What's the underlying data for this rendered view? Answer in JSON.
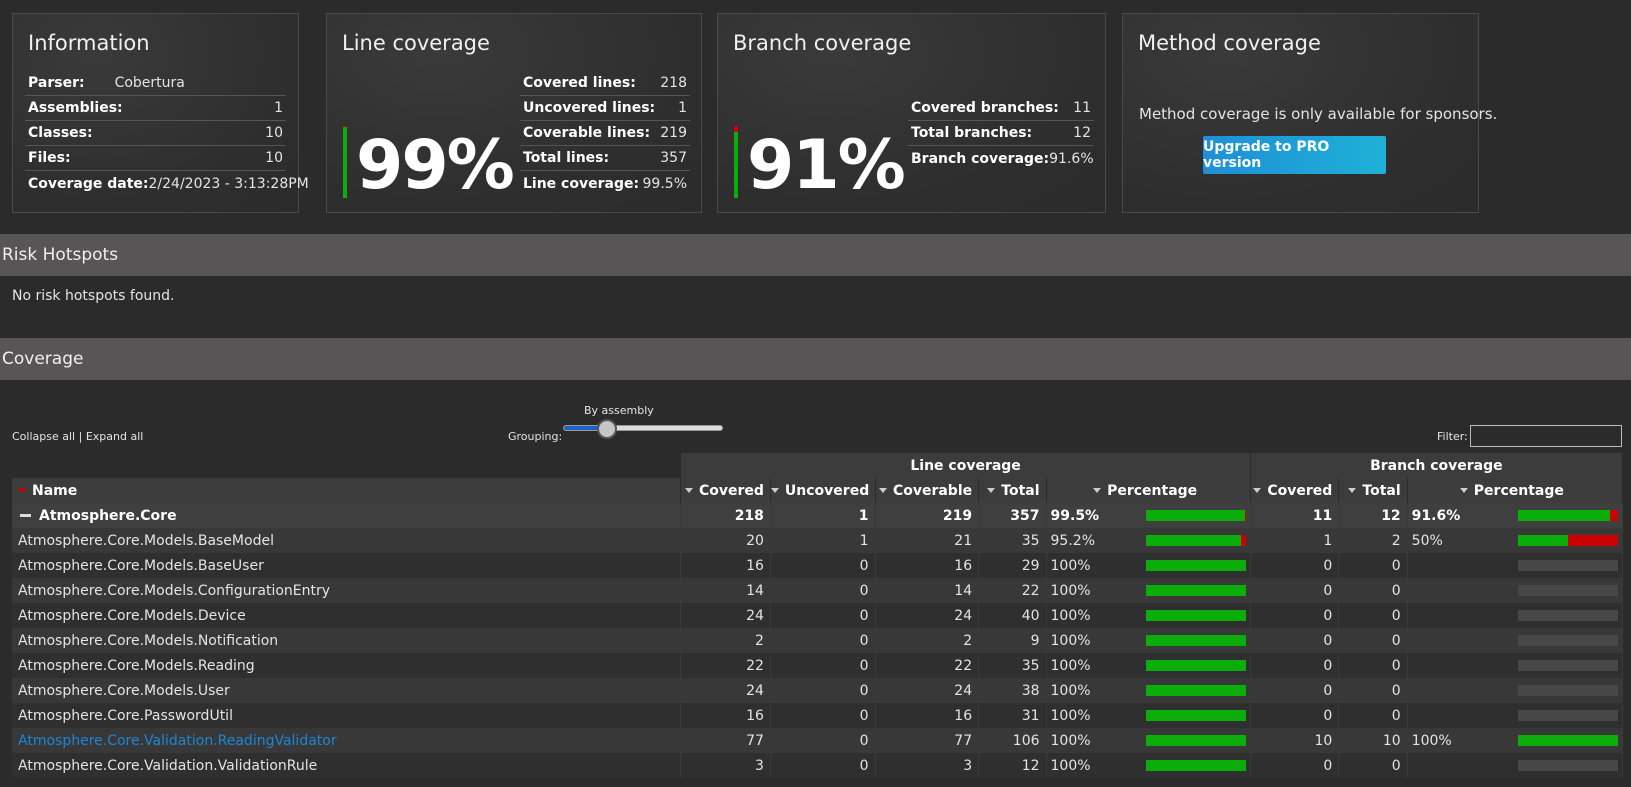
{
  "information": {
    "title": "Information",
    "rows": [
      {
        "k": "Parser:",
        "v": "Cobertura"
      },
      {
        "k": "Assemblies:",
        "v": "1"
      },
      {
        "k": "Classes:",
        "v": "10"
      },
      {
        "k": "Files:",
        "v": "10"
      },
      {
        "k": "Coverage date:",
        "v": "2/24/2023 - 3:13:28PM"
      }
    ]
  },
  "line_coverage": {
    "title": "Line coverage",
    "big": "99%",
    "fraction": 0.995,
    "rows": [
      {
        "k": "Covered lines:",
        "v": "218"
      },
      {
        "k": "Uncovered lines:",
        "v": "1"
      },
      {
        "k": "Coverable lines:",
        "v": "219"
      },
      {
        "k": "Total lines:",
        "v": "357"
      },
      {
        "k": "Line coverage:",
        "v": "99.5%"
      }
    ]
  },
  "branch_coverage": {
    "title": "Branch coverage",
    "big": "91%",
    "fraction": 0.916,
    "rows": [
      {
        "k": "Covered branches:",
        "v": "11"
      },
      {
        "k": "Total branches:",
        "v": "12"
      },
      {
        "k": "Branch coverage:",
        "v": "91.6%"
      }
    ]
  },
  "method_coverage": {
    "title": "Method coverage",
    "text": "Method coverage is only available for sponsors.",
    "button": "Upgrade to PRO version"
  },
  "risk": {
    "title": "Risk Hotspots",
    "empty": "No risk hotspots found."
  },
  "coverage": {
    "title": "Coverage",
    "collapse_all": "Collapse all",
    "separator": "|",
    "expand_all": "Expand all",
    "grouping_label": "Grouping:",
    "grouping_value": "By assembly",
    "filter_label": "Filter:",
    "filter_value": "",
    "group_headers": {
      "line": "Line coverage",
      "branch": "Branch coverage"
    },
    "columns": {
      "name": "Name",
      "covered": "Covered",
      "uncovered": "Uncovered",
      "coverable": "Coverable",
      "total": "Total",
      "percentage": "Percentage",
      "b_covered": "Covered",
      "b_total": "Total",
      "b_percentage": "Percentage"
    },
    "assembly": {
      "name": "Atmosphere.Core",
      "covered": "218",
      "uncovered": "1",
      "coverable": "219",
      "total": "357",
      "pct": "99.5%",
      "line_frac": 0.995,
      "b_covered": "11",
      "b_total": "12",
      "b_pct": "91.6%",
      "branch_frac": 0.916
    },
    "rows": [
      {
        "name": "Atmosphere.Core.Models.BaseModel",
        "covered": "20",
        "uncovered": "1",
        "coverable": "21",
        "total": "35",
        "pct": "95.2%",
        "line_frac": 0.952,
        "b_covered": "1",
        "b_total": "2",
        "b_pct": "50%",
        "branch_frac": 0.5,
        "link": false
      },
      {
        "name": "Atmosphere.Core.Models.BaseUser",
        "covered": "16",
        "uncovered": "0",
        "coverable": "16",
        "total": "29",
        "pct": "100%",
        "line_frac": 1,
        "b_covered": "0",
        "b_total": "0",
        "b_pct": "",
        "branch_frac": null,
        "link": false
      },
      {
        "name": "Atmosphere.Core.Models.ConfigurationEntry",
        "covered": "14",
        "uncovered": "0",
        "coverable": "14",
        "total": "22",
        "pct": "100%",
        "line_frac": 1,
        "b_covered": "0",
        "b_total": "0",
        "b_pct": "",
        "branch_frac": null,
        "link": false
      },
      {
        "name": "Atmosphere.Core.Models.Device",
        "covered": "24",
        "uncovered": "0",
        "coverable": "24",
        "total": "40",
        "pct": "100%",
        "line_frac": 1,
        "b_covered": "0",
        "b_total": "0",
        "b_pct": "",
        "branch_frac": null,
        "link": false
      },
      {
        "name": "Atmosphere.Core.Models.Notification",
        "covered": "2",
        "uncovered": "0",
        "coverable": "2",
        "total": "9",
        "pct": "100%",
        "line_frac": 1,
        "b_covered": "0",
        "b_total": "0",
        "b_pct": "",
        "branch_frac": null,
        "link": false
      },
      {
        "name": "Atmosphere.Core.Models.Reading",
        "covered": "22",
        "uncovered": "0",
        "coverable": "22",
        "total": "35",
        "pct": "100%",
        "line_frac": 1,
        "b_covered": "0",
        "b_total": "0",
        "b_pct": "",
        "branch_frac": null,
        "link": false
      },
      {
        "name": "Atmosphere.Core.Models.User",
        "covered": "24",
        "uncovered": "0",
        "coverable": "24",
        "total": "38",
        "pct": "100%",
        "line_frac": 1,
        "b_covered": "0",
        "b_total": "0",
        "b_pct": "",
        "branch_frac": null,
        "link": false
      },
      {
        "name": "Atmosphere.Core.PasswordUtil",
        "covered": "16",
        "uncovered": "0",
        "coverable": "16",
        "total": "31",
        "pct": "100%",
        "line_frac": 1,
        "b_covered": "0",
        "b_total": "0",
        "b_pct": "",
        "branch_frac": null,
        "link": false
      },
      {
        "name": "Atmosphere.Core.Validation.ReadingValidator",
        "covered": "77",
        "uncovered": "0",
        "coverable": "77",
        "total": "106",
        "pct": "100%",
        "line_frac": 1,
        "b_covered": "10",
        "b_total": "10",
        "b_pct": "100%",
        "branch_frac": 1,
        "link": true
      },
      {
        "name": "Atmosphere.Core.Validation.ValidationRule",
        "covered": "3",
        "uncovered": "0",
        "coverable": "3",
        "total": "12",
        "pct": "100%",
        "line_frac": 1,
        "b_covered": "0",
        "b_total": "0",
        "b_pct": "",
        "branch_frac": null,
        "link": false
      }
    ]
  },
  "colors": {
    "covered": "#0aad0a",
    "uncovered": "#cc0000",
    "accent": "#1c86d6"
  }
}
